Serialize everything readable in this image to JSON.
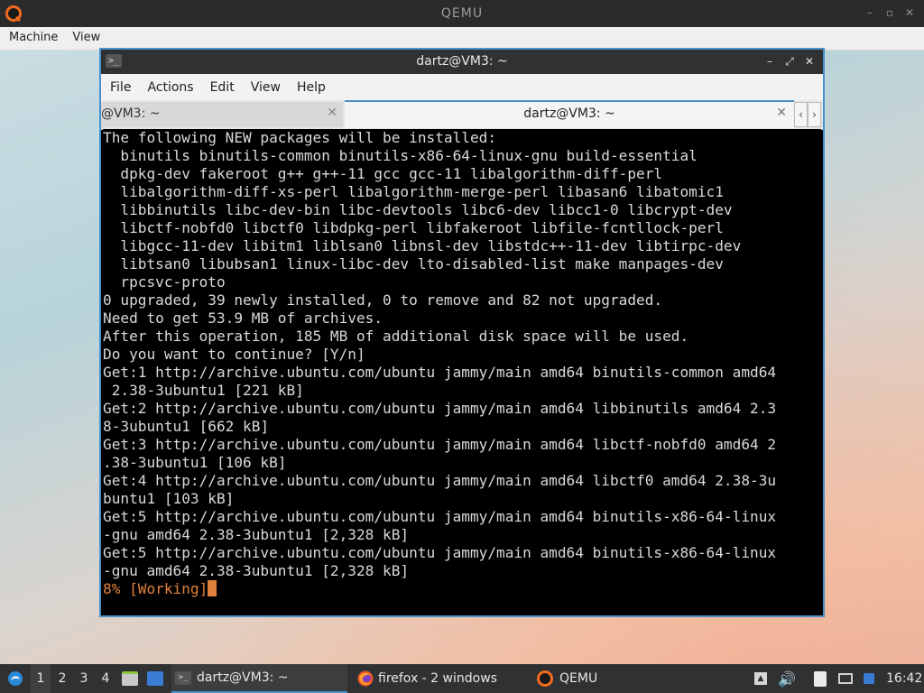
{
  "qemu": {
    "title": "QEMU",
    "menu": [
      "Machine",
      "View"
    ],
    "window_buttons": [
      "–",
      "▫",
      "✕"
    ]
  },
  "terminal": {
    "title": "dartz@VM3: ~",
    "menu": [
      "File",
      "Actions",
      "Edit",
      "View",
      "Help"
    ],
    "tabs": [
      {
        "label": "@VM3: ~",
        "active": false
      },
      {
        "label": "dartz@VM3: ~",
        "active": true
      }
    ],
    "lines": [
      "The following NEW packages will be installed:",
      "  binutils binutils-common binutils-x86-64-linux-gnu build-essential",
      "  dpkg-dev fakeroot g++ g++-11 gcc gcc-11 libalgorithm-diff-perl",
      "  libalgorithm-diff-xs-perl libalgorithm-merge-perl libasan6 libatomic1",
      "  libbinutils libc-dev-bin libc-devtools libc6-dev libcc1-0 libcrypt-dev",
      "  libctf-nobfd0 libctf0 libdpkg-perl libfakeroot libfile-fcntllock-perl",
      "  libgcc-11-dev libitm1 liblsan0 libnsl-dev libstdc++-11-dev libtirpc-dev",
      "  libtsan0 libubsan1 linux-libc-dev lto-disabled-list make manpages-dev",
      "  rpcsvc-proto",
      "0 upgraded, 39 newly installed, 0 to remove and 82 not upgraded.",
      "Need to get 53.9 MB of archives.",
      "After this operation, 185 MB of additional disk space will be used.",
      "Do you want to continue? [Y/n]",
      "Get:1 http://archive.ubuntu.com/ubuntu jammy/main amd64 binutils-common amd64",
      " 2.38-3ubuntu1 [221 kB]",
      "Get:2 http://archive.ubuntu.com/ubuntu jammy/main amd64 libbinutils amd64 2.3",
      "8-3ubuntu1 [662 kB]",
      "Get:3 http://archive.ubuntu.com/ubuntu jammy/main amd64 libctf-nobfd0 amd64 2",
      ".38-3ubuntu1 [106 kB]",
      "Get:4 http://archive.ubuntu.com/ubuntu jammy/main amd64 libctf0 amd64 2.38-3u",
      "buntu1 [103 kB]",
      "Get:5 http://archive.ubuntu.com/ubuntu jammy/main amd64 binutils-x86-64-linux",
      "-gnu amd64 2.38-3ubuntu1 [2,328 kB]",
      "Get:5 http://archive.ubuntu.com/ubuntu jammy/main amd64 binutils-x86-64-linux",
      "-gnu amd64 2.38-3ubuntu1 [2,328 kB]"
    ],
    "status_line": "8% [Working]"
  },
  "taskbar": {
    "workspaces": [
      "1",
      "2",
      "3",
      "4"
    ],
    "tasks": [
      {
        "label": "dartz@VM3: ~",
        "icon": "terminal-icon",
        "active": true
      },
      {
        "label": "firefox - 2 windows",
        "icon": "firefox-icon",
        "active": false
      },
      {
        "label": "QEMU",
        "icon": "qemu-icon",
        "active": false
      }
    ],
    "clock": "16:42"
  },
  "colors": {
    "accent": "#4a90c9",
    "terminal_bg": "#000000",
    "terminal_fg": "#d9d9d9",
    "working": "#e0823d",
    "titlebar": "#2f3133"
  }
}
